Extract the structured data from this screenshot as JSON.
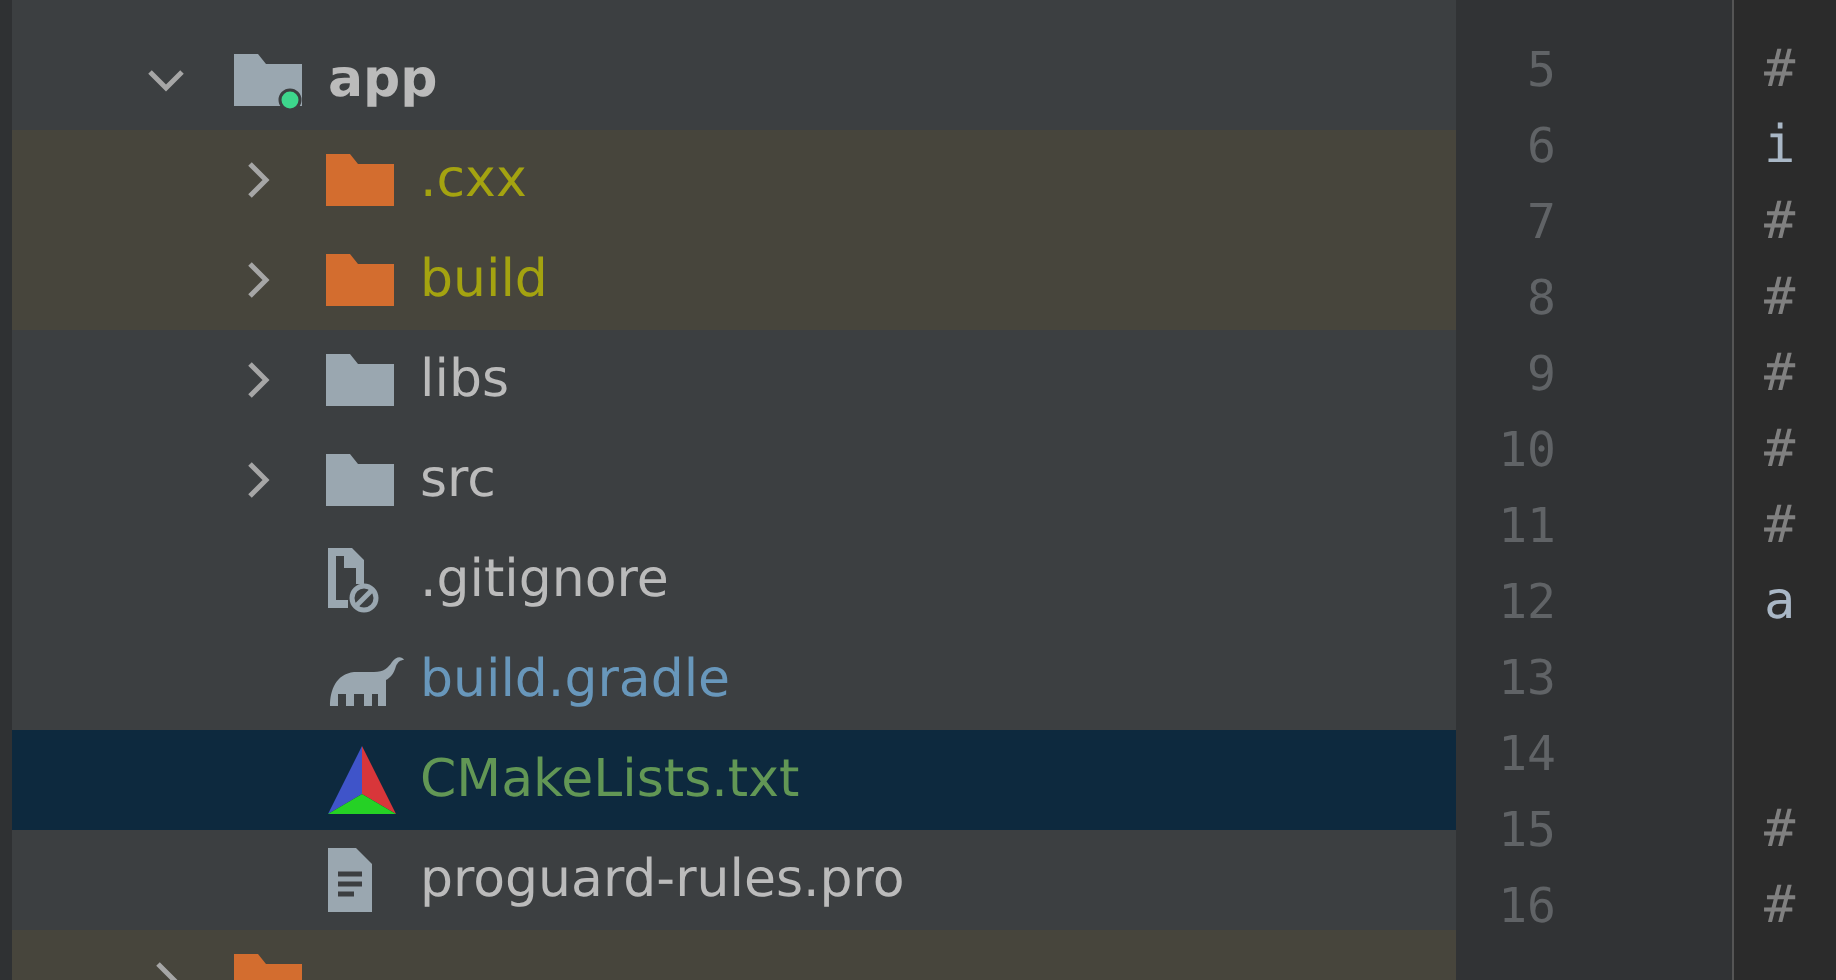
{
  "project_tree": {
    "items": [
      {
        "label": "app",
        "kind": "module",
        "color": "#bbbbbb",
        "expanded": true,
        "selected": false,
        "children": [
          {
            "label": ".cxx",
            "kind": "excluded",
            "color": "#a4a310",
            "expanded": false,
            "selected": false
          },
          {
            "label": "build",
            "kind": "excluded",
            "color": "#a4a310",
            "expanded": false,
            "selected": false
          },
          {
            "label": "libs",
            "kind": "folder",
            "color": "#bbbbbb",
            "expanded": false,
            "selected": false
          },
          {
            "label": "src",
            "kind": "folder",
            "color": "#bbbbbb",
            "expanded": false,
            "selected": false
          },
          {
            "label": ".gitignore",
            "kind": "ignorefile",
            "color": "#bbbbbb",
            "selected": false
          },
          {
            "label": "build.gradle",
            "kind": "gradle",
            "color": "#6897bb",
            "selected": false
          },
          {
            "label": "CMakeLists.txt",
            "kind": "cmake",
            "color": "#629755",
            "selected": true
          },
          {
            "label": "proguard-rules.pro",
            "kind": "textfile",
            "color": "#bbbbbb",
            "selected": false
          }
        ]
      },
      {
        "kind": "excluded",
        "expanded": false,
        "selected": false
      }
    ]
  },
  "editor": {
    "lines": [
      {
        "number": "5",
        "text": "#",
        "kind": "comment"
      },
      {
        "number": "6",
        "text": "i",
        "kind": "code"
      },
      {
        "number": "7",
        "text": "#",
        "kind": "comment"
      },
      {
        "number": "8",
        "text": "#",
        "kind": "comment"
      },
      {
        "number": "9",
        "text": "#",
        "kind": "comment"
      },
      {
        "number": "10",
        "text": "#",
        "kind": "comment"
      },
      {
        "number": "11",
        "text": "#",
        "kind": "comment"
      },
      {
        "number": "12",
        "text": "a",
        "kind": "code"
      },
      {
        "number": "13",
        "kind": "code"
      },
      {
        "number": "14",
        "kind": "code"
      },
      {
        "number": "15",
        "text": "#",
        "kind": "comment"
      },
      {
        "number": "16",
        "text": "#",
        "kind": "comment"
      }
    ]
  }
}
